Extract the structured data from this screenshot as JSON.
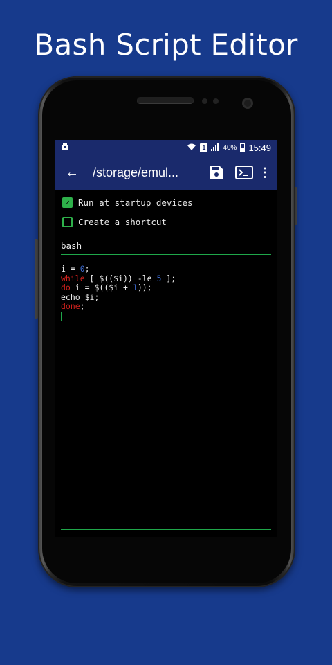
{
  "promo": {
    "title": "Bash Script Editor"
  },
  "statusbar": {
    "battery": "40%",
    "sim": "1",
    "time": "15:49"
  },
  "toolbar": {
    "back_glyph": "←",
    "title": "/storage/emul...",
    "menu_glyph": "⋮"
  },
  "options": {
    "run_at_startup": {
      "label": "Run at startup devices",
      "checked": true
    },
    "create_shortcut": {
      "label": "Create a shortcut",
      "checked": false
    }
  },
  "interpreter": {
    "value": "bash"
  },
  "code": {
    "line1": [
      "i = ",
      "0",
      ";"
    ],
    "line2": [
      "while",
      " [ $(($i)) -le ",
      "5",
      " ];"
    ],
    "line3": [
      "do",
      " i = $(($i + ",
      "1",
      "));"
    ],
    "line4": [
      "echo $i;"
    ],
    "line5": [
      "done",
      ";"
    ]
  },
  "colors": {
    "background": "#173a8c",
    "accent_green": "#1fa74a",
    "keyword": "#d0211d",
    "number": "#3f6fd8",
    "appbar": "#1a2a6c"
  }
}
